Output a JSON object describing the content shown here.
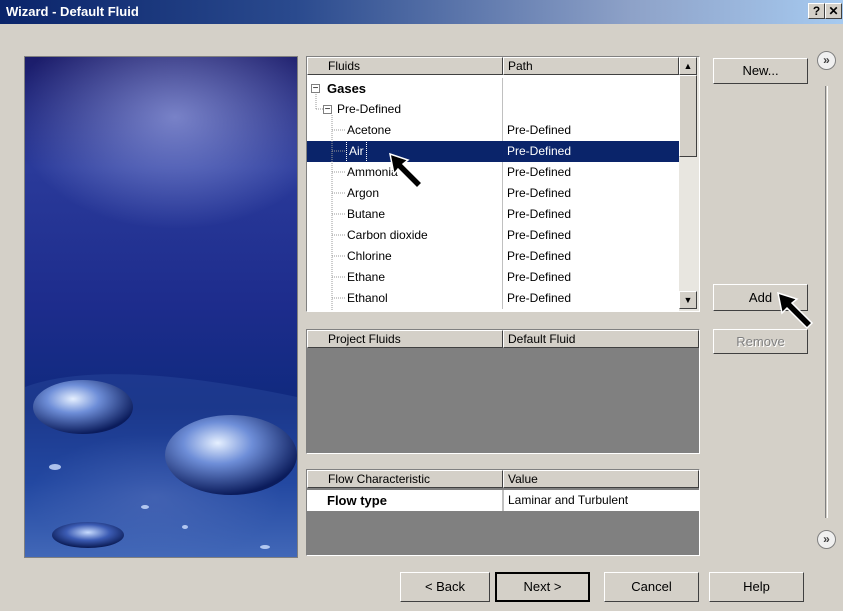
{
  "window": {
    "title": "Wizard - Default Fluid",
    "help_label": "?",
    "close_label": "✕"
  },
  "fluids_list": {
    "headers": {
      "name": "Fluids",
      "path": "Path"
    },
    "group": "Gases",
    "subgroup": "Pre-Defined",
    "items": [
      {
        "name": "Acetone",
        "path": "Pre-Defined"
      },
      {
        "name": "Air",
        "path": "Pre-Defined"
      },
      {
        "name": "Ammonia",
        "path": "Pre-Defined"
      },
      {
        "name": "Argon",
        "path": "Pre-Defined"
      },
      {
        "name": "Butane",
        "path": "Pre-Defined"
      },
      {
        "name": "Carbon dioxide",
        "path": "Pre-Defined"
      },
      {
        "name": "Chlorine",
        "path": "Pre-Defined"
      },
      {
        "name": "Ethane",
        "path": "Pre-Defined"
      },
      {
        "name": "Ethanol",
        "path": "Pre-Defined"
      }
    ],
    "selected": "Air"
  },
  "project_fluids": {
    "headers": {
      "name": "Project Fluids",
      "default": "Default Fluid"
    }
  },
  "flow": {
    "headers": {
      "name": "Flow Characteristic",
      "value": "Value"
    },
    "row": {
      "name": "Flow type",
      "value": "Laminar and Turbulent"
    }
  },
  "buttons": {
    "new": "New...",
    "add": "Add",
    "remove": "Remove",
    "back": "< Back",
    "next": "Next >",
    "cancel": "Cancel",
    "help": "Help"
  },
  "panel_toggles": {
    "top": "»",
    "bottom": "»"
  },
  "icons": [
    "arrow-up-icon",
    "arrow-down-icon",
    "tree-expander-icon",
    "mouse-pointer-icon",
    "chevron-double-right-icon"
  ]
}
